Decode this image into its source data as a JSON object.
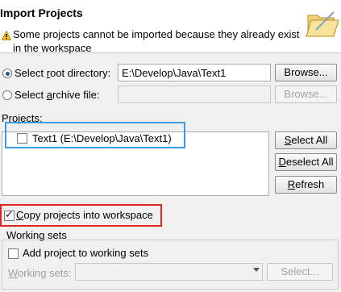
{
  "header": {
    "title": "Import Projects",
    "warning": "Some projects cannot be imported because they already exist in the workspace"
  },
  "source": {
    "root_directory": {
      "label_prefix": "Select ",
      "label_mnemonic": "r",
      "label_suffix": "oot directory:",
      "selected": true,
      "value": "E:\\Develop\\Java\\Text1",
      "browse_label": "Browse..."
    },
    "archive_file": {
      "label_prefix": "Select ",
      "label_mnemonic": "a",
      "label_suffix": "rchive file:",
      "selected": false,
      "value": "",
      "browse_label": "Browse..."
    }
  },
  "projects": {
    "label": "Projects:",
    "items": [
      {
        "label": "Text1 (E:\\Develop\\Java\\Text1)",
        "checked": false
      }
    ],
    "select_all": {
      "mnemonic": "S",
      "rest": "elect All"
    },
    "deselect_all": {
      "mnemonic": "D",
      "rest": "eselect All"
    },
    "refresh": {
      "mnemonic": "R",
      "rest": "efresh"
    }
  },
  "copy_projects": {
    "label_mnemonic": "C",
    "label_rest": "opy projects into workspace",
    "checked": true
  },
  "working_sets": {
    "group_label": "Working sets",
    "add_label": "Add project to working sets",
    "add_checked": false,
    "combo_label_mnemonic": "W",
    "combo_label_rest": "orking sets:",
    "combo_value": "",
    "select_button": "Select..."
  },
  "colors": {
    "highlight_blue": "#3a9be0",
    "highlight_red": "#e02424",
    "warning_yellow": "#f5c518"
  }
}
